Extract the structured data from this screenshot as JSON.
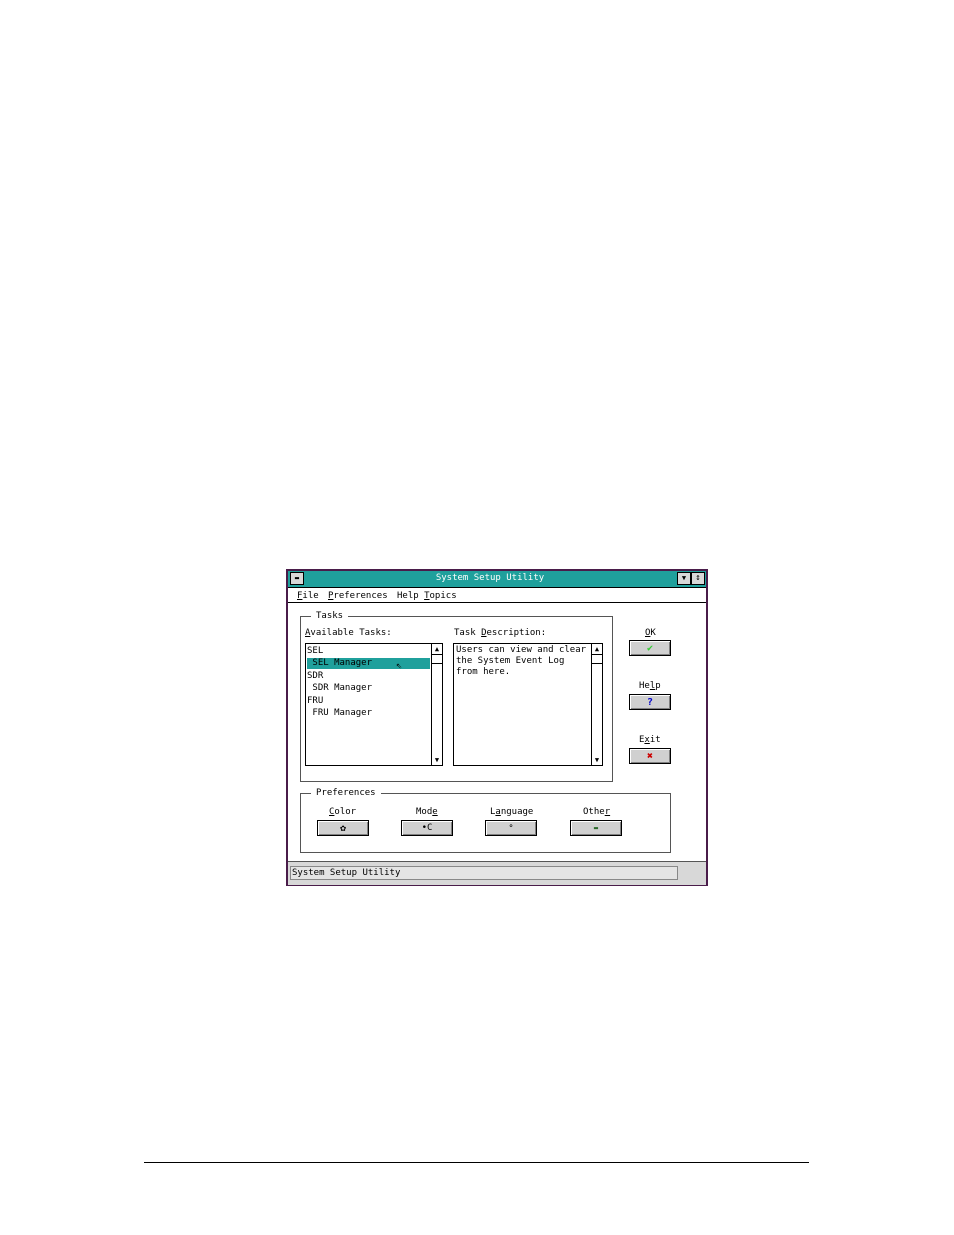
{
  "window": {
    "title": "System Setup Utility",
    "system_menu_icon": "dash-icon",
    "minimize_icon": "triangle-down-icon",
    "maximize_icon": "updown-arrows-icon",
    "accent_color": "#1fa09c"
  },
  "menubar": {
    "items": [
      {
        "mnemonic": "F",
        "rest": "ile"
      },
      {
        "mnemonic": "P",
        "rest": "references"
      },
      {
        "prefix": "Help ",
        "mnemonic": "T",
        "rest": "opics"
      }
    ]
  },
  "tasks": {
    "group_label": "Tasks",
    "available_label": {
      "mnemonic": "A",
      "rest": "vailable Tasks:"
    },
    "description_label": {
      "prefix": "Task ",
      "mnemonic": "D",
      "rest": "escription:"
    },
    "items": [
      {
        "text": "SEL",
        "selected": false
      },
      {
        "text": " SEL Manager",
        "selected": true
      },
      {
        "text": "SDR",
        "selected": false
      },
      {
        "text": " SDR Manager",
        "selected": false
      },
      {
        "text": "FRU",
        "selected": false
      },
      {
        "text": " FRU Manager",
        "selected": false
      }
    ],
    "description": "Users can view and clear\nthe System Event Log\nfrom here."
  },
  "side_buttons": {
    "ok": {
      "mnemonic": "O",
      "rest": "K",
      "icon": "check-icon",
      "icon_color": "#33cc33"
    },
    "help": {
      "prefix": "He",
      "mnemonic": "l",
      "rest": "p",
      "icon": "question-icon",
      "icon_color": "#0000cc"
    },
    "exit": {
      "prefix": "E",
      "mnemonic": "x",
      "rest": "it",
      "icon": "x-icon",
      "icon_color": "#cc0000"
    }
  },
  "preferences": {
    "group_label": "Preferences",
    "color": {
      "mnemonic": "C",
      "rest": "olor",
      "icon": "palette-icon"
    },
    "mode": {
      "prefix": "Mod",
      "mnemonic": "e",
      "rest": "",
      "icon": "mode-icon"
    },
    "language": {
      "prefix": "L",
      "mnemonic": "a",
      "rest": "nguage",
      "icon": "language-icon"
    },
    "other": {
      "prefix": "Othe",
      "mnemonic": "r",
      "rest": "",
      "icon": "other-icon"
    }
  },
  "statusbar": {
    "text": "System Setup Utility"
  },
  "glyphs": {
    "dash": "▬",
    "tri_down": "▼",
    "updown": "↕",
    "up": "▲",
    "down": "▼",
    "check": "✔",
    "question": "?",
    "x": "✖",
    "palette": "✿",
    "mode": "•C",
    "language": "ᐤ",
    "other": "▬",
    "cursor": "⇖"
  }
}
